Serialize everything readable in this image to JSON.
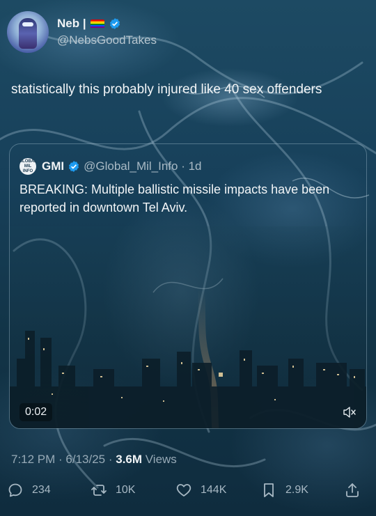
{
  "author": {
    "name": "Neb |",
    "flag_colors": [
      "#e40303",
      "#ff8c00",
      "#ffed00",
      "#008026",
      "#004dff",
      "#750787"
    ],
    "handle": "@NebsGoodTakes"
  },
  "tweet": {
    "text": "statistically this probably injured like 40 sex offenders"
  },
  "quoted": {
    "logo_text": "GLOBAL MIL INFO",
    "name": "GMI",
    "handle_time": "@Global_Mil_Info · 1d",
    "text": "BREAKING: Multiple ballistic missile impacts have been reported in downtown Tel Aviv.",
    "video": {
      "time": "0:02",
      "icon": "mute-icon"
    }
  },
  "meta": {
    "datetime": "7:12 PM · 6/13/25 · ",
    "views_count": "3.6M",
    "views_label": " Views"
  },
  "actions": {
    "replies": "234",
    "reposts": "10K",
    "likes": "144K",
    "bookmarks": "2.9K"
  },
  "colors": {
    "verified": "#1d9bf0",
    "accent_text": "#f2f5f7",
    "secondary_text": "#a9bac5"
  }
}
